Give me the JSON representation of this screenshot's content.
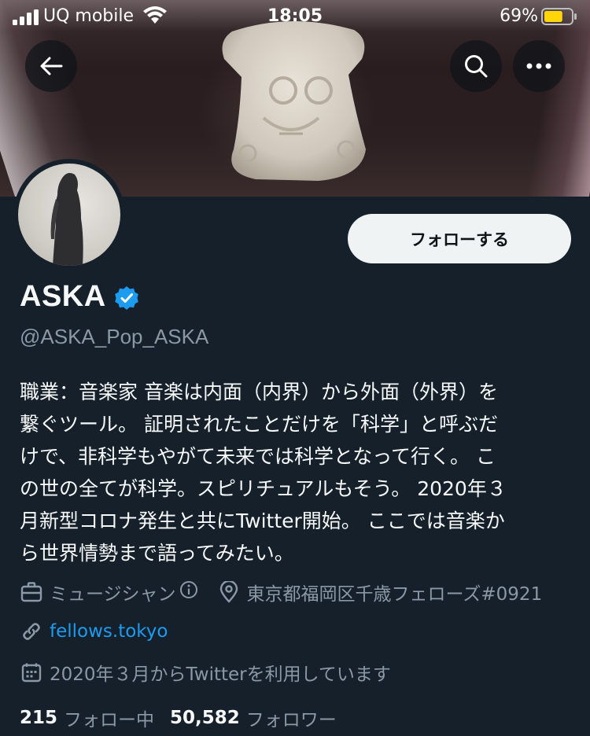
{
  "status_bar": {
    "carrier": "UQ mobile",
    "time": "18:05",
    "battery_percent": "69%",
    "battery_level": 0.69,
    "battery_color": "#ffd60a"
  },
  "nav": {
    "back_icon": "arrow-left-icon",
    "search_icon": "search-icon",
    "more_icon": "more-horizontal-icon"
  },
  "profile": {
    "name": "ASKA",
    "verified": true,
    "verified_color": "#1d9bf0",
    "handle": "@ASKA_Pop_ASKA",
    "follow_label": "フォローする",
    "bio_lines": [
      "職業：音楽家 音楽は内面（内界）から外面（外界）を",
      "繋ぐツール。 証明されたことだけを「科学」と呼ぶだ",
      "けで、非科学もやがて未来では科学となって行く。 こ",
      "の世の全てが科学。スピリチュアルもそう。 2020年３",
      "月新型コロナ発生と共にTwitter開始。 ここでは音楽か",
      "ら世界情勢まで語ってみたい。"
    ],
    "category": "ミュージシャン",
    "location": "東京都福岡区千歳フェローズ#0921",
    "website": "fellows.tokyo",
    "joined": "2020年３月からTwitterを利用しています",
    "following_count": "215",
    "following_label": "フォロー中",
    "followers_count": "50,582",
    "followers_label": "フォロワー"
  },
  "colors": {
    "background": "#15202b",
    "secondary_text": "#8b98a5",
    "link": "#1d9bf0"
  }
}
